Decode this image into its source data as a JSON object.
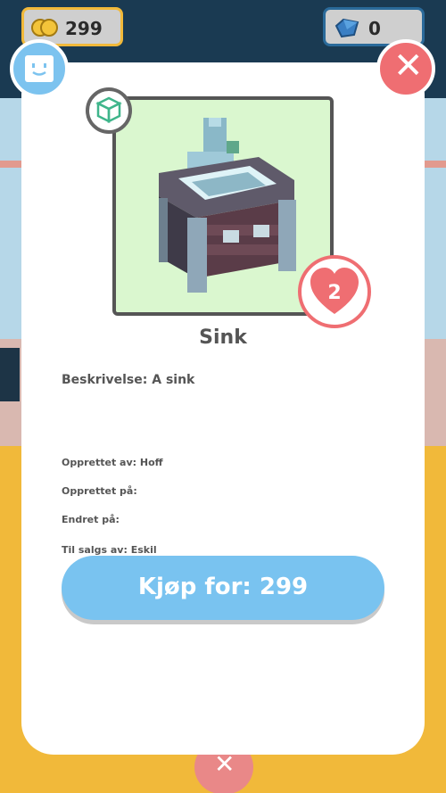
{
  "currency": {
    "coins": "299",
    "gems": "0"
  },
  "item": {
    "name": "Sink",
    "likes": "2",
    "description": "Beskrivelse: A sink",
    "created_by": "Opprettet av: Hoff",
    "created_on": "Opprettet på:",
    "modified_on": "Endret på:",
    "for_sale_by": "Til salgs av: Eskil"
  },
  "buy_button": {
    "label": "Kjøp for: 299"
  },
  "colors": {
    "accent_blue": "#79c3f0",
    "close_red": "#ef6e72",
    "preview_bg": "#daf7cf"
  },
  "icons": [
    "coin-icon",
    "gem-icon",
    "avatar-face-icon",
    "close-icon",
    "cube-icon",
    "heart-icon",
    "sink-model-image"
  ]
}
